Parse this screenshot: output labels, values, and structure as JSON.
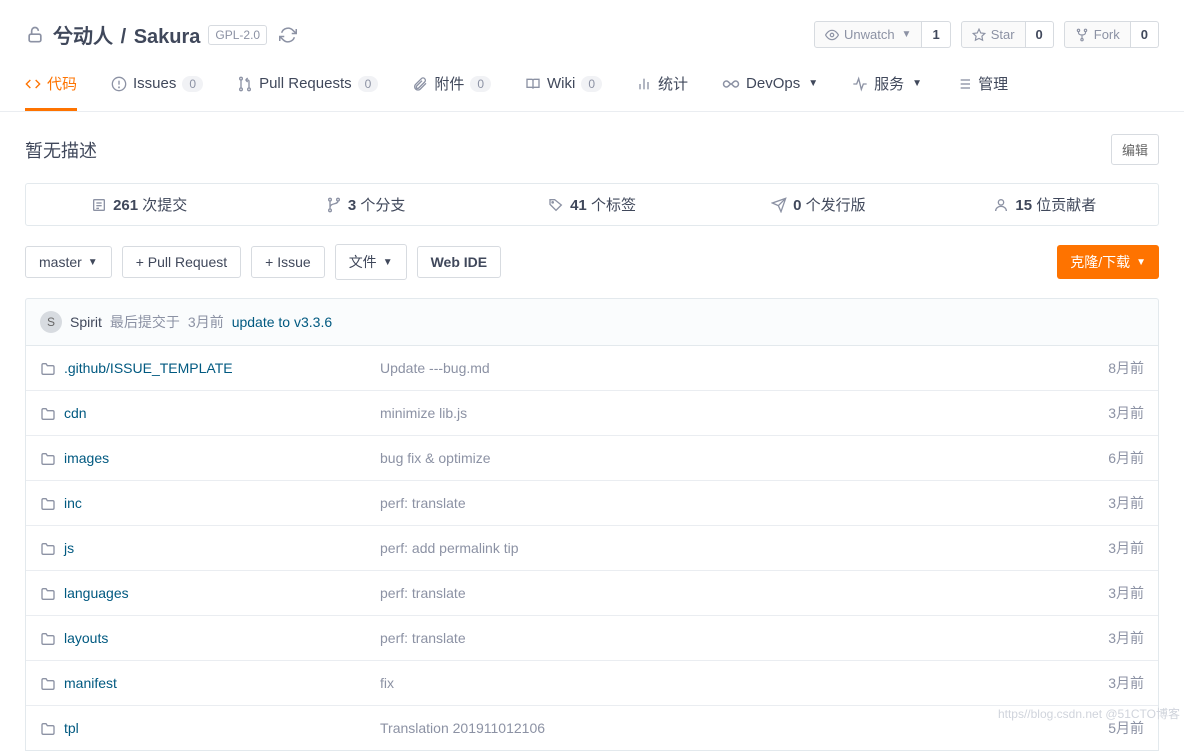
{
  "repo": {
    "owner": "兮动人",
    "slash": "/",
    "name": "Sakura",
    "license": "GPL-2.0"
  },
  "actions": {
    "unwatch": {
      "label": "Unwatch",
      "count": "1"
    },
    "star": {
      "label": "Star",
      "count": "0"
    },
    "fork": {
      "label": "Fork",
      "count": "0"
    }
  },
  "tabs": {
    "code": "代码",
    "issues": {
      "label": "Issues",
      "count": "0"
    },
    "pulls": {
      "label": "Pull Requests",
      "count": "0"
    },
    "attach": {
      "label": "附件",
      "count": "0"
    },
    "wiki": {
      "label": "Wiki",
      "count": "0"
    },
    "stats": "统计",
    "devops": "DevOps",
    "service": "服务",
    "manage": "管理"
  },
  "description": "暂无描述",
  "edit_label": "编辑",
  "stats": {
    "commits": {
      "num": "261",
      "label": "次提交"
    },
    "branches": {
      "num": "3",
      "label": "个分支"
    },
    "tags": {
      "num": "41",
      "label": "个标签"
    },
    "releases": {
      "num": "0",
      "label": "个发行版"
    },
    "contribs": {
      "num": "15",
      "label": "位贡献者"
    }
  },
  "toolbar": {
    "branch": "master",
    "pr": "+ Pull Request",
    "issue": "+ Issue",
    "file": "文件",
    "webide": "Web IDE",
    "clone": "克隆/下载"
  },
  "last_commit": {
    "avatar": "S",
    "author": "Spirit",
    "prefix": "最后提交于",
    "time": "3月前",
    "msg": "update to v3.3.6"
  },
  "files": [
    {
      "name": ".github/ISSUE_TEMPLATE",
      "msg": "Update ---bug.md",
      "time": "8月前"
    },
    {
      "name": "cdn",
      "msg": "minimize lib.js",
      "time": "3月前"
    },
    {
      "name": "images",
      "msg": "bug fix & optimize",
      "time": "6月前"
    },
    {
      "name": "inc",
      "msg": "perf: translate",
      "time": "3月前"
    },
    {
      "name": "js",
      "msg": "perf: add permalink tip",
      "time": "3月前"
    },
    {
      "name": "languages",
      "msg": "perf: translate",
      "time": "3月前"
    },
    {
      "name": "layouts",
      "msg": "perf: translate",
      "time": "3月前"
    },
    {
      "name": "manifest",
      "msg": "fix",
      "time": "3月前"
    },
    {
      "name": "tpl",
      "msg": "Translation 201911012106",
      "time": "5月前"
    }
  ],
  "watermark": "https//blog.csdn.net  @51CTO博客"
}
